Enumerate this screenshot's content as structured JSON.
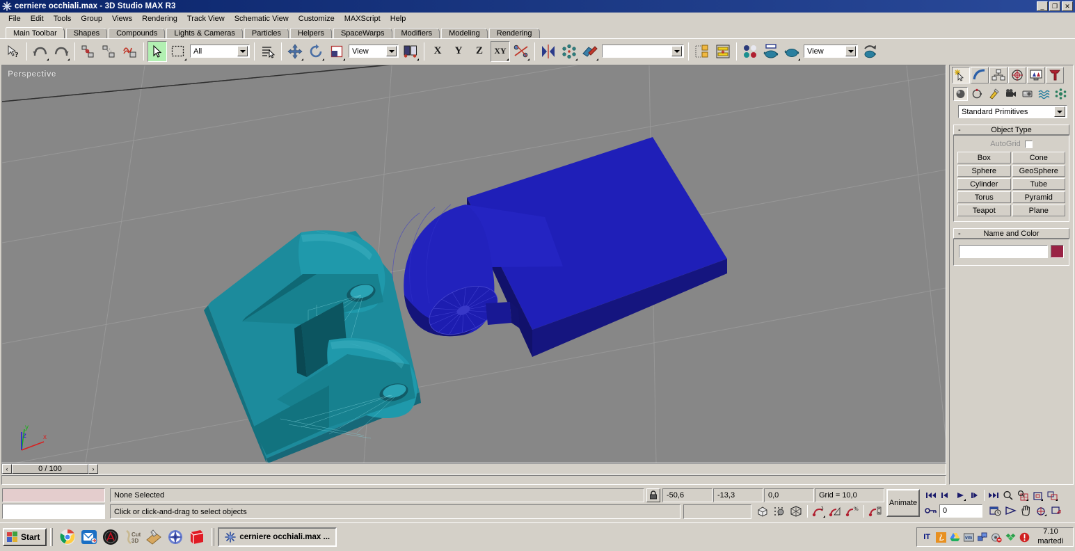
{
  "window": {
    "title": "cerniere occhiali.max - 3D Studio MAX R3",
    "icon": "max-star-icon",
    "minimize": "_",
    "maximize": "❐",
    "close": "✕"
  },
  "menu": {
    "items": [
      {
        "label": "File"
      },
      {
        "label": "Edit"
      },
      {
        "label": "Tools"
      },
      {
        "label": "Group"
      },
      {
        "label": "Views"
      },
      {
        "label": "Rendering"
      },
      {
        "label": "Track View"
      },
      {
        "label": "Schematic View"
      },
      {
        "label": "Customize"
      },
      {
        "label": "MAXScript"
      },
      {
        "label": "Help"
      }
    ]
  },
  "tabs": {
    "active": "Main Toolbar",
    "items": [
      {
        "label": "Main Toolbar"
      },
      {
        "label": "Shapes"
      },
      {
        "label": "Compounds"
      },
      {
        "label": "Lights & Cameras"
      },
      {
        "label": "Particles"
      },
      {
        "label": "Helpers"
      },
      {
        "label": "SpaceWarps"
      },
      {
        "label": "Modifiers"
      },
      {
        "label": "Modeling"
      },
      {
        "label": "Rendering"
      }
    ]
  },
  "toolbar": {
    "undo_tooltip": "Undo",
    "redo_tooltip": "Redo",
    "selection_filter": "All",
    "reference_coordinate_system": "View",
    "named_selection_sets": "",
    "viewport_layout": "View",
    "buttons": [
      {
        "name": "select-object-help-icon",
        "label": ""
      },
      {
        "name": "undo-icon",
        "label": ""
      },
      {
        "name": "redo-icon",
        "label": ""
      },
      {
        "name": "select-and-link-icon",
        "label": ""
      },
      {
        "name": "unlink-selection-icon",
        "label": ""
      },
      {
        "name": "bind-to-space-warp-icon",
        "label": ""
      },
      {
        "name": "select-object-icon",
        "label": ""
      },
      {
        "name": "select-region-icon",
        "label": ""
      },
      {
        "name": "select-by-name-icon",
        "label": ""
      },
      {
        "name": "select-and-move-icon",
        "label": ""
      },
      {
        "name": "select-and-rotate-icon",
        "label": ""
      },
      {
        "name": "select-and-scale-icon",
        "label": ""
      },
      {
        "name": "axis-constraint-x",
        "label": "X"
      },
      {
        "name": "axis-constraint-y",
        "label": "Y"
      },
      {
        "name": "axis-constraint-z",
        "label": "Z"
      },
      {
        "name": "axis-constraint-xy",
        "label": "XY"
      },
      {
        "name": "align-icon",
        "label": ""
      },
      {
        "name": "mirror-icon",
        "label": ""
      },
      {
        "name": "array-icon",
        "label": ""
      },
      {
        "name": "normal-align-icon",
        "label": ""
      },
      {
        "name": "snapshot-icon",
        "label": ""
      },
      {
        "name": "spacing-tool-icon",
        "label": ""
      },
      {
        "name": "material-editor-icon",
        "label": ""
      },
      {
        "name": "render-scene-icon",
        "label": ""
      },
      {
        "name": "quick-render-icon",
        "label": ""
      },
      {
        "name": "render-type-icon",
        "label": ""
      }
    ]
  },
  "viewport": {
    "label": "Perspective",
    "background_color": "#878787",
    "grid_line_color": "#9a9a9a",
    "axis": {
      "x": "x",
      "y": "y",
      "z": "z"
    },
    "objects": [
      {
        "name": "hinge-leaf-teal",
        "color": "#1a8fa0"
      },
      {
        "name": "hinge-leaf-blue",
        "color": "#1a1ab4"
      }
    ]
  },
  "timeline": {
    "prev_label": "‹",
    "next_label": "›",
    "frame_range": "0 / 100"
  },
  "statusbar": {
    "object_name": "",
    "selection_status": "None Selected",
    "prompt": "Click or click-and-drag to select objects",
    "lock_icon": "lock-selection-icon",
    "coords": [
      {
        "name": "x-coordinate",
        "value": "-50,6"
      },
      {
        "name": "y-coordinate",
        "value": "-13,3"
      },
      {
        "name": "z-coordinate",
        "value": "0,0"
      },
      {
        "name": "grid-size",
        "value": "Grid = 10,0"
      }
    ],
    "snap_buttons": [
      {
        "name": "snap-toggle-icon"
      },
      {
        "name": "angle-snap-toggle-icon"
      },
      {
        "name": "percent-snap-toggle-icon"
      },
      {
        "name": "spinner-snap-toggle-icon"
      }
    ],
    "animate_label": "Animate",
    "current_frame": "0",
    "playback_buttons": [
      {
        "name": "go-to-start-button"
      },
      {
        "name": "previous-frame-button"
      },
      {
        "name": "play-animation-button"
      },
      {
        "name": "next-frame-button"
      },
      {
        "name": "go-to-end-button"
      },
      {
        "name": "zoom-button"
      },
      {
        "name": "zoom-all-button"
      },
      {
        "name": "zoom-extents-button"
      },
      {
        "name": "zoom-extents-all-button"
      },
      {
        "name": "key-mode-toggle-button"
      },
      {
        "name": "time-configuration-button"
      },
      {
        "name": "field-of-view-button"
      },
      {
        "name": "pan-button"
      },
      {
        "name": "arc-rotate-button"
      },
      {
        "name": "min-max-toggle-button"
      }
    ]
  },
  "command_panel": {
    "tabs": [
      {
        "name": "create-tab",
        "active": true
      },
      {
        "name": "modify-tab",
        "active": false
      },
      {
        "name": "hierarchy-tab",
        "active": false
      },
      {
        "name": "motion-tab",
        "active": false
      },
      {
        "name": "display-tab",
        "active": false
      },
      {
        "name": "utilities-tab",
        "active": false
      }
    ],
    "subtabs": [
      {
        "name": "geometry-subtab",
        "active": true
      },
      {
        "name": "shapes-subtab",
        "active": false
      },
      {
        "name": "lights-subtab",
        "active": false
      },
      {
        "name": "cameras-subtab",
        "active": false
      },
      {
        "name": "helpers-subtab",
        "active": false
      },
      {
        "name": "space-warps-subtab",
        "active": false
      },
      {
        "name": "systems-subtab",
        "active": false
      }
    ],
    "category": "Standard Primitives",
    "object_type": {
      "title": "Object Type",
      "collapse": "-",
      "autogrid_label": "AutoGrid",
      "autogrid_checked": false,
      "buttons": [
        "Box",
        "Cone",
        "Sphere",
        "GeoSphere",
        "Cylinder",
        "Tube",
        "Torus",
        "Pyramid",
        "Teapot",
        "Plane"
      ]
    },
    "name_and_color": {
      "title": "Name and Color",
      "collapse": "-",
      "name_value": "",
      "color": "#992244"
    }
  },
  "taskbar": {
    "start_label": "Start",
    "quick_launch": [
      {
        "name": "chrome-icon"
      },
      {
        "name": "outlook-express-icon"
      },
      {
        "name": "autocad-icon"
      },
      {
        "name": "cut3d-icon"
      },
      {
        "name": "vcarve-icon"
      },
      {
        "name": "compass-icon"
      },
      {
        "name": "sketchup-icon"
      }
    ],
    "task_button": {
      "name": "max-task-button",
      "label": "cerniere occhiali.max ..."
    },
    "tray": {
      "language": "IT",
      "icons": [
        {
          "name": "java-icon"
        },
        {
          "name": "google-drive-icon"
        },
        {
          "name": "vm-icon"
        },
        {
          "name": "network-icon"
        },
        {
          "name": "audio-icon"
        },
        {
          "name": "dropbox-icon"
        },
        {
          "name": "security-alert-icon"
        }
      ],
      "clock_time": "7.10",
      "clock_day": "martedì"
    }
  }
}
